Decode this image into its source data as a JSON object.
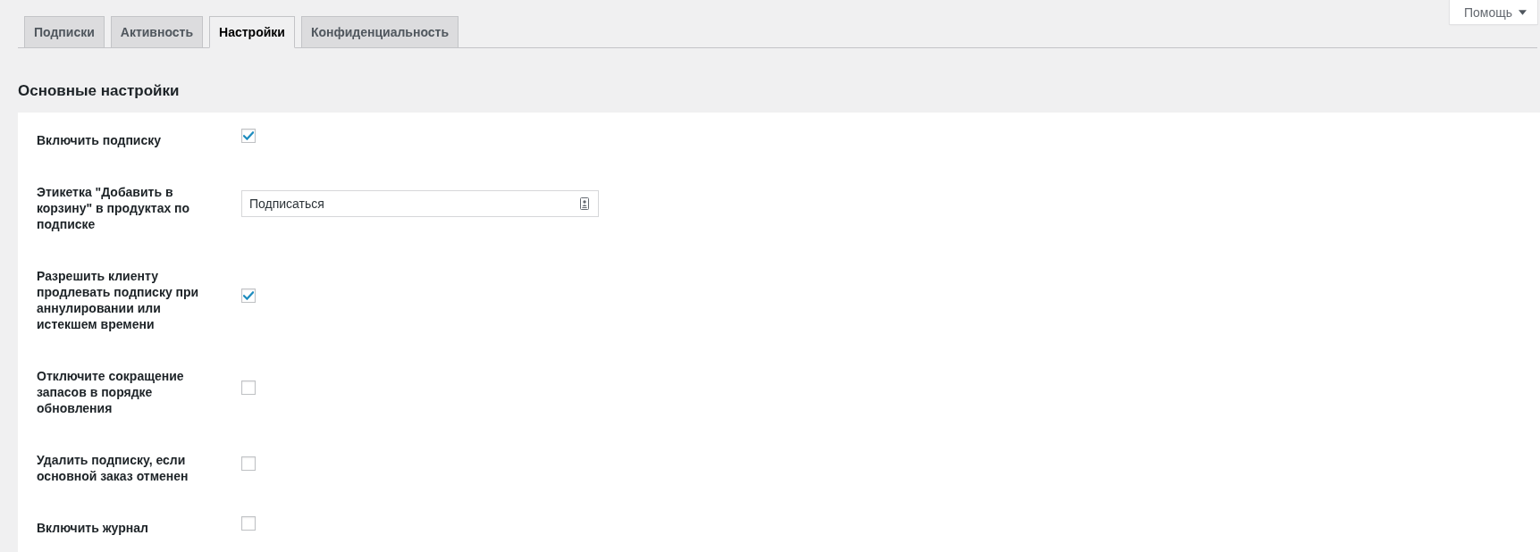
{
  "help_button": {
    "label": "Помощь"
  },
  "tabs": [
    {
      "label": "Подписки",
      "selected": false
    },
    {
      "label": "Активность",
      "selected": false
    },
    {
      "label": "Настройки",
      "selected": true
    },
    {
      "label": "Конфиденциальность",
      "selected": false
    }
  ],
  "section": {
    "title": "Основные настройки",
    "settings": [
      {
        "kind": "checkbox",
        "label": "Включить подписку",
        "checked": true
      },
      {
        "kind": "text",
        "label": "Этикетка \"Добавить в корзину\" в продуктах по подписке",
        "value": "Подписаться"
      },
      {
        "kind": "checkbox",
        "label": "Разрешить клиенту продлевать подписку при аннулировании или истекшем времени",
        "checked": true
      },
      {
        "kind": "checkbox",
        "label": "Отключите сокращение запасов в порядке обновления",
        "checked": false
      },
      {
        "kind": "checkbox",
        "label": "Удалить подписку, если основной заказ отменен",
        "checked": false
      },
      {
        "kind": "checkbox",
        "label": "Включить журнал",
        "checked": false
      }
    ]
  }
}
